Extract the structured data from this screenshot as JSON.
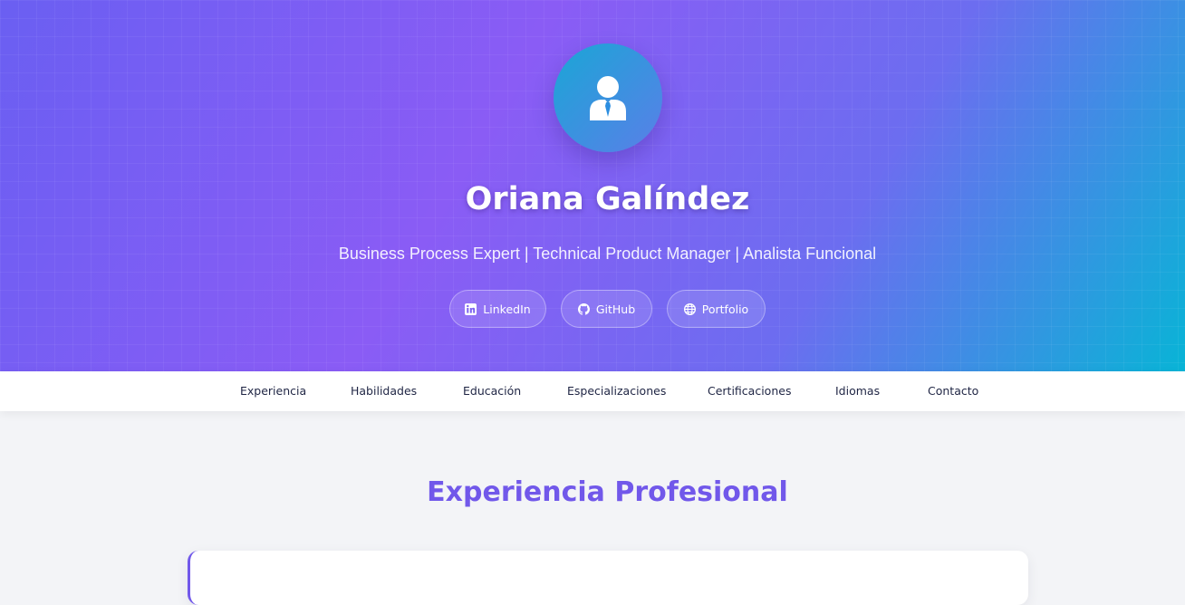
{
  "header": {
    "avatar_icon": "user-tie-icon",
    "name": "Oriana Galíndez",
    "tagline": "Business Process Expert | Technical Product Manager | Analista Funcional",
    "links": [
      {
        "label": "LinkedIn",
        "icon": "linkedin-icon"
      },
      {
        "label": "GitHub",
        "icon": "github-icon"
      },
      {
        "label": "Portfolio",
        "icon": "globe-icon"
      }
    ]
  },
  "nav": {
    "items": [
      "Experiencia",
      "Habilidades",
      "Educación",
      "Especializaciones",
      "Certificaciones",
      "Idiomas",
      "Contacto"
    ]
  },
  "main": {
    "section_title": "Experiencia Profesional"
  },
  "colors": {
    "accent": "#7158ea",
    "nav_text": "#1f2544",
    "gradient_start": "#6a5ff2",
    "gradient_end": "#08b4d6"
  }
}
